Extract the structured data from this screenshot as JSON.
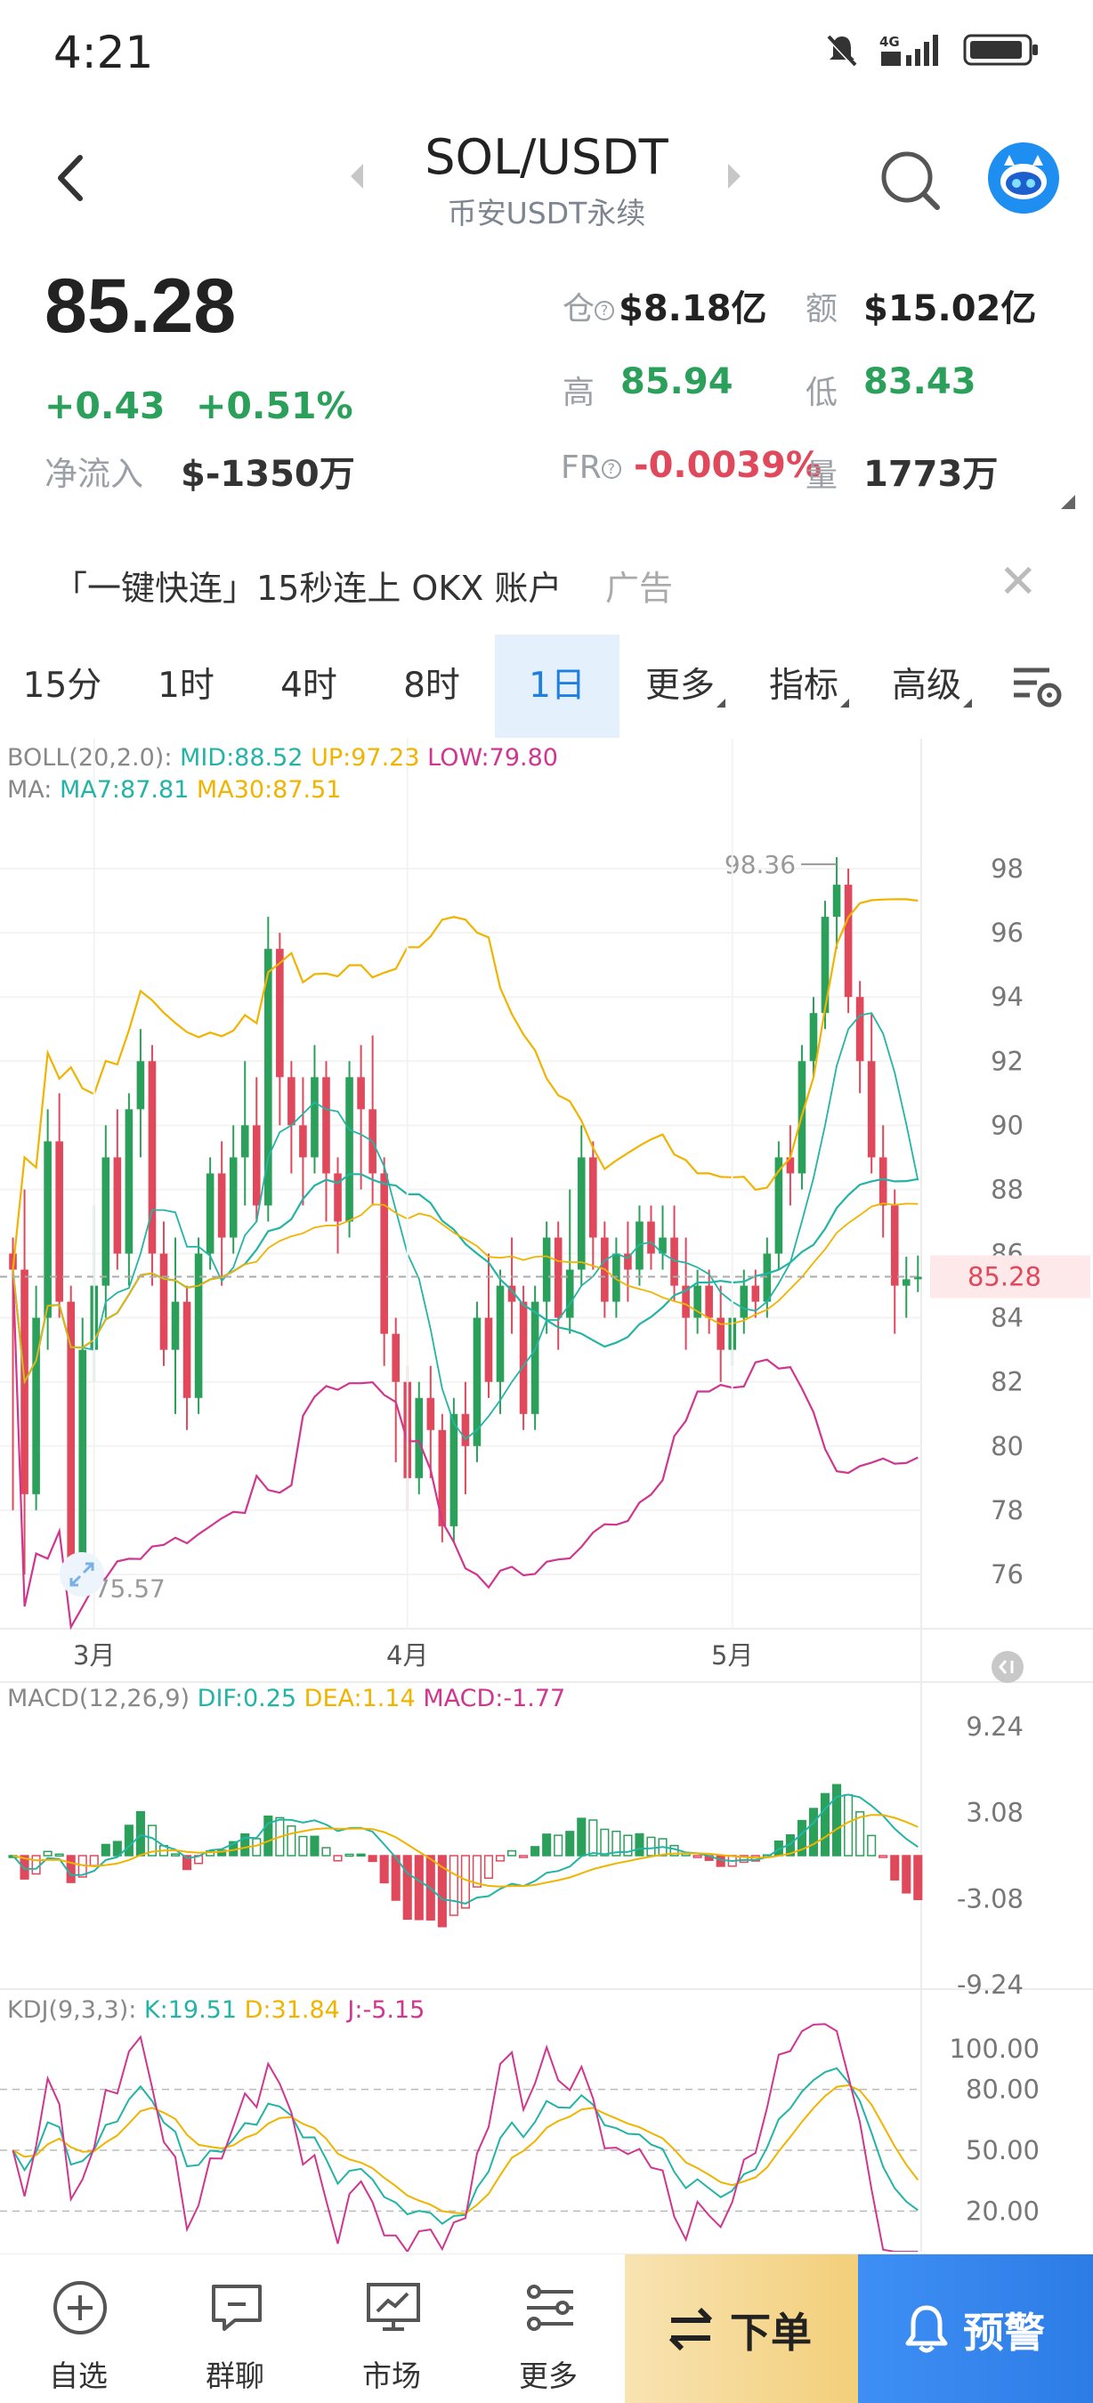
{
  "status": {
    "time": "4:21",
    "network": "4G"
  },
  "header": {
    "symbol": "SOL/USDT",
    "subtitle": "币安USDT永续"
  },
  "price": {
    "last": "85.28",
    "change": "+0.43",
    "change_pct": "+0.51%",
    "netflow_label": "净流入",
    "netflow_value": "$-1350万"
  },
  "stats": {
    "oi_label": "仓",
    "oi_value": "$8.18亿",
    "amount_label": "额",
    "amount_value": "$15.02亿",
    "high_label": "高",
    "high_value": "85.94",
    "low_label": "低",
    "low_value": "83.43",
    "fr_label": "FR",
    "fr_value": "-0.0039%",
    "vol_label": "量",
    "vol_value": "1773万"
  },
  "ad": {
    "text": "「一键快连」15秒连上 OKX 账户",
    "tag": "广告"
  },
  "tabs": [
    {
      "label": "15分"
    },
    {
      "label": "1时"
    },
    {
      "label": "4时"
    },
    {
      "label": "8时"
    },
    {
      "label": "1日",
      "active": true
    },
    {
      "label": "更多"
    },
    {
      "label": "指标"
    },
    {
      "label": "高级"
    }
  ],
  "legends": {
    "boll": {
      "name": "BOLL(20,2.0):",
      "mid": "MID:88.52",
      "up": "UP:97.23",
      "low": "LOW:79.80"
    },
    "ma": {
      "name": "MA:",
      "ma7": "MA7:87.81",
      "ma30": "MA30:87.51"
    },
    "macd": {
      "name": "MACD(12,26,9)",
      "dif": "DIF:0.25",
      "dea": "DEA:1.14",
      "macd": "MACD:-1.77"
    },
    "kdj": {
      "name": "KDJ(9,3,3):",
      "k": "K:19.51",
      "d": "D:31.84",
      "j": "J:-5.15"
    }
  },
  "chart_data": [
    {
      "type": "candlestick",
      "y_ticks": [
        "98",
        "96",
        "94",
        "92",
        "90",
        "88",
        "86",
        "84",
        "82",
        "80",
        "78",
        "76"
      ],
      "ylim": [
        75,
        99
      ],
      "x_ticks": [
        "3月",
        "4月",
        "5月"
      ],
      "current_price": "85.28",
      "max_label": "98.36",
      "min_label": "75.57",
      "candles": [
        [
          86,
          85.5,
          78,
          86.5
        ],
        [
          85.5,
          78.5,
          76,
          88
        ],
        [
          78.5,
          84,
          78,
          85
        ],
        [
          84,
          89.5,
          83,
          90.5
        ],
        [
          89.5,
          84.5,
          84,
          91
        ],
        [
          84.5,
          76.5,
          75.57,
          85
        ],
        [
          76.5,
          83,
          76,
          84
        ],
        [
          83,
          85,
          82,
          87.5
        ],
        [
          85,
          89,
          84,
          90
        ],
        [
          89,
          86,
          85.5,
          90.5
        ],
        [
          86,
          90.5,
          85,
          91
        ],
        [
          90.5,
          92,
          89,
          93
        ],
        [
          92,
          86,
          85,
          92.5
        ],
        [
          86,
          83,
          82.5,
          87
        ],
        [
          83,
          84.5,
          81,
          86.5
        ],
        [
          84.5,
          81.5,
          80.5,
          85
        ],
        [
          81.5,
          86,
          81,
          86.5
        ],
        [
          86,
          88.5,
          85.5,
          89
        ],
        [
          88.5,
          86.5,
          85,
          89.5
        ],
        [
          86.5,
          89,
          86,
          90
        ],
        [
          89,
          90,
          87.5,
          92
        ],
        [
          90,
          87.5,
          87,
          91.5
        ],
        [
          87.5,
          95.5,
          87,
          96.5
        ],
        [
          95.5,
          91.5,
          90,
          96
        ],
        [
          91.5,
          90,
          88.5,
          92
        ],
        [
          90,
          89,
          87.5,
          91.5
        ],
        [
          89,
          91.5,
          88.5,
          92.5
        ],
        [
          91.5,
          88.5,
          87,
          92
        ],
        [
          88.5,
          87,
          86,
          89
        ],
        [
          87,
          91.5,
          86.5,
          92
        ],
        [
          91.5,
          90.5,
          88,
          92.5
        ],
        [
          90.5,
          88.5,
          87.5,
          92.8
        ],
        [
          88.5,
          83.5,
          82.5,
          89
        ],
        [
          83.5,
          82,
          79.5,
          84
        ],
        [
          82,
          79,
          78,
          82.5
        ],
        [
          79,
          81.5,
          78.5,
          82
        ],
        [
          81.5,
          80.5,
          79,
          82.5
        ],
        [
          80.5,
          77.5,
          77,
          81
        ],
        [
          77.5,
          81,
          77,
          81.5
        ],
        [
          81,
          80,
          78.5,
          82
        ],
        [
          80,
          84,
          79.5,
          84.5
        ],
        [
          84,
          82,
          81.5,
          86
        ],
        [
          82,
          85,
          81,
          85.5
        ],
        [
          85,
          84.5,
          83.5,
          86.5
        ],
        [
          84.5,
          81,
          80.5,
          85
        ],
        [
          81,
          84.5,
          80.5,
          85
        ],
        [
          84.5,
          86.5,
          83.5,
          87
        ],
        [
          86.5,
          84,
          83,
          87
        ],
        [
          84,
          85.5,
          83.5,
          88
        ],
        [
          85.5,
          89,
          85,
          90
        ],
        [
          89,
          86.5,
          85.5,
          89.5
        ],
        [
          86.5,
          84.5,
          84,
          87
        ],
        [
          84.5,
          86,
          84,
          86.5
        ],
        [
          86,
          85.5,
          84.5,
          87
        ],
        [
          85.5,
          87,
          85,
          87.5
        ],
        [
          87,
          86,
          85.5,
          87.5
        ],
        [
          86,
          86.5,
          85.5,
          87.5
        ],
        [
          86.5,
          85,
          84.5,
          87.5
        ],
        [
          85,
          84,
          83,
          86.5
        ],
        [
          84,
          85,
          83.5,
          85.5
        ],
        [
          85,
          84,
          83.5,
          85.5
        ],
        [
          84,
          83,
          82,
          85
        ],
        [
          83,
          84,
          82.5,
          84.5
        ],
        [
          84,
          85,
          83.5,
          85.5
        ],
        [
          85,
          84.5,
          84,
          85.5
        ],
        [
          84.5,
          86,
          84,
          86.5
        ],
        [
          86,
          89,
          85.5,
          89.5
        ],
        [
          89,
          88.5,
          87.5,
          90
        ],
        [
          88.5,
          92,
          88,
          92.5
        ],
        [
          92,
          93.5,
          91.5,
          94
        ],
        [
          93.5,
          96.5,
          93,
          97
        ],
        [
          96.5,
          97.5,
          95.5,
          98.36
        ],
        [
          97.5,
          94,
          93.5,
          98
        ],
        [
          94,
          92,
          91,
          94.5
        ],
        [
          92,
          89,
          88.5,
          93.5
        ],
        [
          89,
          87.5,
          86.5,
          90
        ],
        [
          87.5,
          85,
          83.5,
          88
        ],
        [
          85,
          85.2,
          84,
          85.9
        ],
        [
          85.2,
          85.28,
          84.8,
          85.94
        ]
      ],
      "overlays": [
        {
          "name": "UP",
          "color": "#f0b400"
        },
        {
          "name": "MID",
          "color": "#24b4a5"
        },
        {
          "name": "LOW",
          "color": "#d0368f"
        },
        {
          "name": "MA7",
          "color": "#24b4a5"
        },
        {
          "name": "MA30",
          "color": "#f0b400"
        }
      ]
    },
    {
      "type": "bar",
      "title": "MACD(12,26,9)",
      "y_ticks": [
        "9.24",
        "3.08",
        "-3.08",
        "-9.24"
      ],
      "ylim": [
        -9.24,
        9.24
      ]
    },
    {
      "type": "line",
      "title": "KDJ(9,3,3)",
      "y_ticks": [
        "100.00",
        "80.00",
        "50.00",
        "20.00"
      ],
      "ylim": [
        0,
        100
      ]
    }
  ],
  "bottom_nav": [
    {
      "label": "自选",
      "icon": "add-circle-icon"
    },
    {
      "label": "群聊",
      "icon": "chat-icon"
    },
    {
      "label": "市场",
      "icon": "market-icon"
    },
    {
      "label": "更多",
      "icon": "more-icon"
    }
  ],
  "buttons": {
    "order": "下单",
    "alert": "预警"
  },
  "colors": {
    "up": "#2ba05a",
    "down": "#e0485b",
    "accent": "#1f7fe0"
  }
}
